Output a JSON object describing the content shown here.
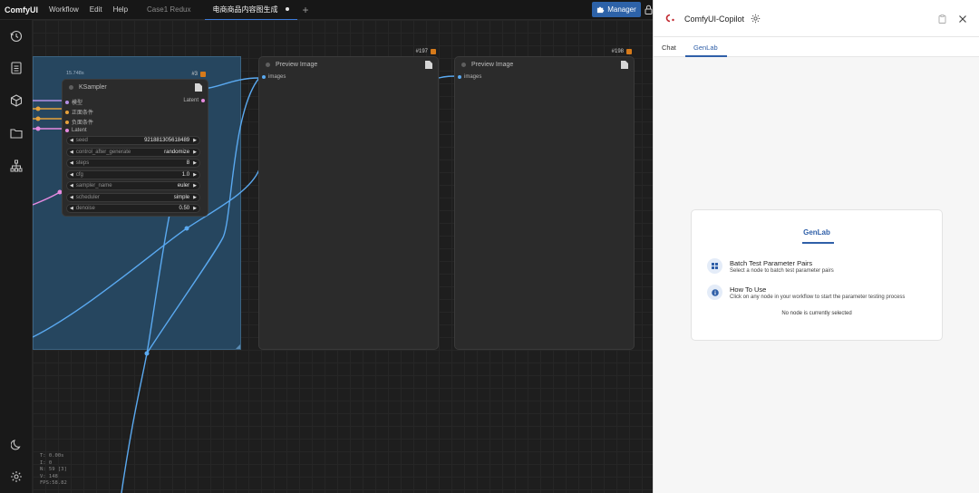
{
  "topbar": {
    "brand": "ComfyUI",
    "menus": [
      "Workflow",
      "Edit",
      "Help"
    ],
    "tabs": [
      {
        "label": "Case1 Redux",
        "active": false
      },
      {
        "label": "电商商品内容图生成",
        "active": true
      }
    ],
    "manager_label": "Manager",
    "icons": {
      "add_tab": "plus-icon",
      "manager": "puzzle-icon",
      "lock": "lock-icon"
    }
  },
  "sidebar": {
    "top_icons": [
      "history-icon",
      "document-list-icon",
      "cube-icon",
      "folder-icon",
      "node-tree-icon"
    ],
    "bottom_icons": [
      "moon-icon",
      "settings-icon"
    ]
  },
  "canvas": {
    "group_size_label": "15.748s",
    "ksampler": {
      "id": "#3",
      "title": "KSampler",
      "inputs": [
        {
          "label": "模型",
          "color": "#b48fe6"
        },
        {
          "label": "正面条件",
          "color": "#e6a23c"
        },
        {
          "label": "负面条件",
          "color": "#e6a23c"
        },
        {
          "label": "Latent",
          "color": "#e58ae0"
        }
      ],
      "output": {
        "label": "Latent",
        "color": "#e58ae0"
      },
      "widgets": [
        {
          "label": "seed",
          "value": "921881305618489"
        },
        {
          "label": "control_after_generate",
          "value": "randomize"
        },
        {
          "label": "steps",
          "value": "8"
        },
        {
          "label": "cfg",
          "value": "1.0"
        },
        {
          "label": "sampler_name",
          "value": "euler"
        },
        {
          "label": "scheduler",
          "value": "simple"
        },
        {
          "label": "denoise",
          "value": "0.50"
        }
      ]
    },
    "preview1": {
      "id": "#197",
      "title": "Preview Image",
      "input": "images"
    },
    "preview2": {
      "id": "#198",
      "title": "Preview Image",
      "input": "images"
    },
    "stats": [
      "T: 0.00s",
      "I: 0",
      "N: 59 [3]",
      "V: 148",
      "FPS:58.82"
    ],
    "link_color": "#5aa9f0"
  },
  "panel": {
    "title": "ComfyUI-Copilot",
    "tabs": [
      {
        "label": "Chat",
        "active": false
      },
      {
        "label": "GenLab",
        "active": true
      }
    ],
    "card": {
      "title": "GenLab",
      "items": [
        {
          "icon": "grid-icon",
          "title": "Batch Test Parameter Pairs",
          "subtitle": "Select a node to batch test parameter pairs"
        },
        {
          "icon": "info-icon",
          "title": "How To Use",
          "subtitle": "Click on any node in your workflow to start the parameter testing process"
        }
      ],
      "footer": "No node is currently selected"
    },
    "accent": "#2f5fa8"
  }
}
